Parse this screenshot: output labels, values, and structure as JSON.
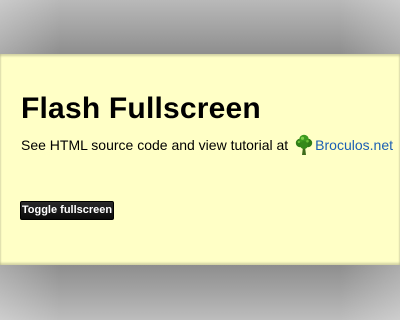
{
  "header": {
    "title": "Flash Fullscreen",
    "subtitle_text": "See HTML source code and view tutorial at",
    "site_link_label": "Broculos.net"
  },
  "icons": {
    "site_logo": "broccoli-tree-icon"
  },
  "controls": {
    "toggle_label": "Toggle fullscreen"
  },
  "colors": {
    "content_background": "#ffffc6",
    "bars": "#a2a2a2",
    "link": "#1b5fb4",
    "button_background": "#111111",
    "button_text": "#ffffff"
  }
}
